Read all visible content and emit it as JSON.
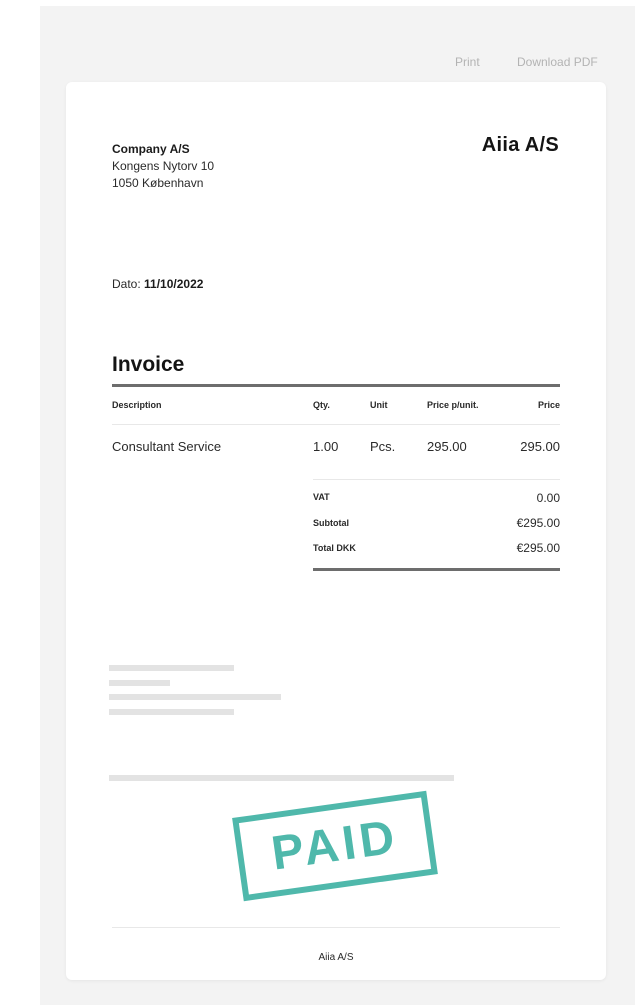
{
  "actions": {
    "print_label": "Print",
    "download_label": "Download PDF"
  },
  "sender": {
    "name": "Company A/S",
    "street": "Kongens Nytorv 10",
    "city": "1050 København"
  },
  "recipient": {
    "name": "Aiia A/S"
  },
  "date": {
    "label": "Dato:",
    "value": "11/10/2022"
  },
  "invoice": {
    "title": "Invoice",
    "columns": {
      "description": "Description",
      "qty": "Qty.",
      "unit": "Unit",
      "price_per_unit": "Price p/unit.",
      "price": "Price"
    },
    "items": [
      {
        "description": "Consultant Service",
        "qty": "1.00",
        "unit": "Pcs.",
        "price_per_unit": "295.00",
        "price": "295.00"
      }
    ],
    "summary": {
      "vat_label": "VAT",
      "vat_value": "0.00",
      "subtotal_label": "Subtotal",
      "subtotal_value": "€295.00",
      "total_label": "Total DKK",
      "total_value": "€295.00"
    }
  },
  "stamp": {
    "text": "PAID",
    "color": "#4fb8ab"
  },
  "footer": {
    "text": "Aiia A/S"
  }
}
